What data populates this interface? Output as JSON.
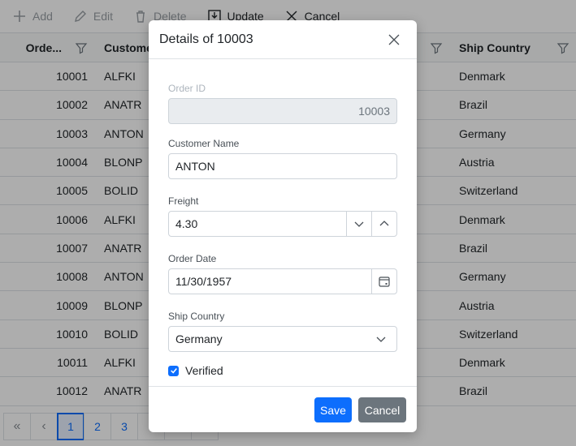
{
  "toolbar": {
    "add_label": "Add",
    "edit_label": "Edit",
    "delete_label": "Delete",
    "update_label": "Update",
    "cancel_label": "Cancel"
  },
  "grid": {
    "headers": {
      "order_id": "Orde...",
      "customer": "Custome",
      "ship_country": "Ship Country"
    },
    "rows": [
      {
        "id": "10001",
        "customer": "ALFKI",
        "country": "Denmark"
      },
      {
        "id": "10002",
        "customer": "ANATR",
        "country": "Brazil"
      },
      {
        "id": "10003",
        "customer": "ANTON",
        "country": "Germany"
      },
      {
        "id": "10004",
        "customer": "BLONP",
        "country": "Austria"
      },
      {
        "id": "10005",
        "customer": "BOLID",
        "country": "Switzerland"
      },
      {
        "id": "10006",
        "customer": "ALFKI",
        "country": "Denmark"
      },
      {
        "id": "10007",
        "customer": "ANATR",
        "country": "Brazil"
      },
      {
        "id": "10008",
        "customer": "ANTON",
        "country": "Germany"
      },
      {
        "id": "10009",
        "customer": "BLONP",
        "country": "Austria"
      },
      {
        "id": "10010",
        "customer": "BOLID",
        "country": "Switzerland"
      },
      {
        "id": "10011",
        "customer": "ALFKI",
        "country": "Denmark"
      },
      {
        "id": "10012",
        "customer": "ANATR",
        "country": "Brazil"
      }
    ]
  },
  "pager": {
    "first": "«",
    "prev": "‹",
    "pages": [
      "1",
      "2",
      "3"
    ],
    "current_page": "1"
  },
  "dialog": {
    "title": "Details of 10003",
    "order_id_label": "Order ID",
    "order_id_value": "10003",
    "customer_label": "Customer Name",
    "customer_value": "ANTON",
    "freight_label": "Freight",
    "freight_value": "4.30",
    "order_date_label": "Order Date",
    "order_date_value": "11/30/1957",
    "ship_country_label": "Ship Country",
    "ship_country_value": "Germany",
    "verified_label": "Verified",
    "save_label": "Save",
    "cancel_label": "Cancel"
  },
  "colors": {
    "primary": "#0d6efd",
    "secondary": "#6c757d",
    "overlay": "rgba(0,0,0,0.32)"
  },
  "icons": {
    "add": "plus-icon",
    "edit": "pencil-icon",
    "delete": "trash-icon",
    "update": "save-icon",
    "cancel": "close-icon",
    "filter": "filter-icon",
    "spin_down": "chevron-down-icon",
    "spin_up": "chevron-up-icon",
    "calendar": "calendar-icon",
    "dropdown": "chevron-down-icon",
    "check": "check-icon"
  }
}
